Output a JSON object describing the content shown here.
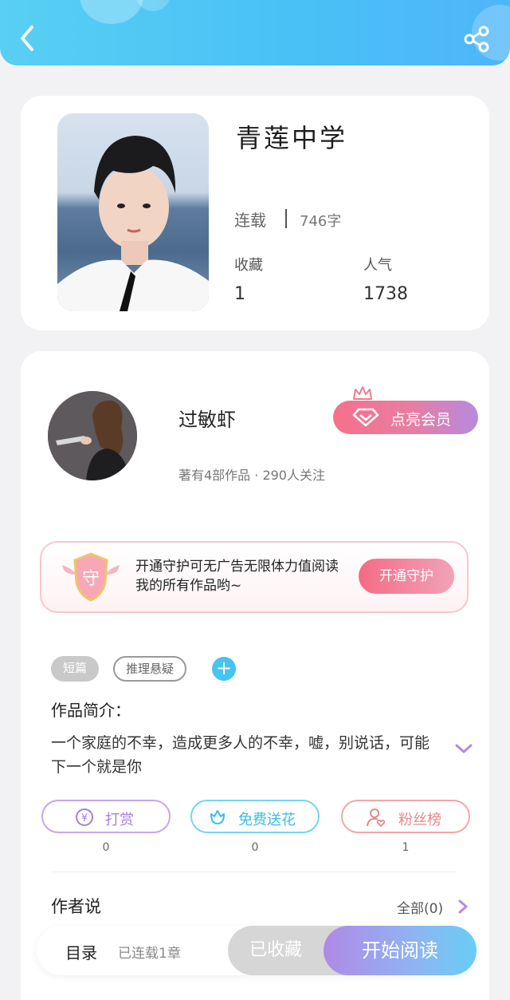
{
  "header": {
    "back_icon": "chevron-left-icon",
    "share_icon": "share-icon",
    "bg_color": "#4cc4f6"
  },
  "book": {
    "title": "青莲中学",
    "status": "连载",
    "word_count": "746字",
    "collect_label": "收藏",
    "collect_value": "1",
    "popularity_label": "人气",
    "popularity_value": "1738"
  },
  "author": {
    "name": "过敏虾",
    "meta": "著有4部作品 · 290人关注",
    "vip_button": "点亮会员",
    "vip_icon": "diamond-icon",
    "crown_icon": "crown-icon"
  },
  "guard": {
    "badge_char": "守",
    "text": "开通守护可无广告无限体力值阅读我的所有作品哟~",
    "button": "开通守护"
  },
  "tags": [
    "短篇",
    "推理悬疑"
  ],
  "intro": {
    "label": "作品简介：",
    "text": "一个家庭的不幸，造成更多人的不幸，嘘，别说话，可能下一个就是你"
  },
  "actions": [
    {
      "label": "打赏",
      "icon": "yen-icon",
      "count": "0",
      "color": "#a77fdb"
    },
    {
      "label": "免费送花",
      "icon": "flower-icon",
      "count": "0",
      "color": "#39bde6"
    },
    {
      "label": "粉丝榜",
      "icon": "user-heart-icon",
      "count": "1",
      "color": "#e48a8a"
    }
  ],
  "author_says": {
    "label": "作者说",
    "all": "全部(0)"
  },
  "bottom": {
    "toc": "目录",
    "toc_status": "已连载1章",
    "collected": "已收藏",
    "start_read": "开始阅读"
  }
}
